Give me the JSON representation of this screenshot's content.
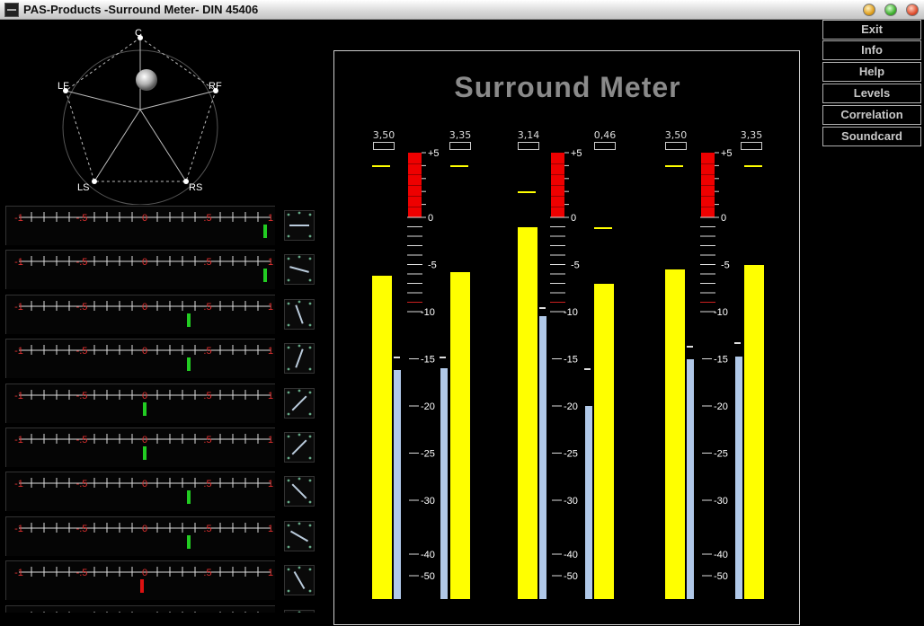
{
  "window": {
    "title": "PAS-Products -Surround Meter- DIN 45406"
  },
  "colors": {
    "meter": "#ffff00",
    "meter_secondary": "#b0c8e8",
    "over": "#ee0000",
    "corr_ok": "#22cc22",
    "corr_bad": "#dd1111",
    "background": "#000000"
  },
  "pentagon": {
    "labels": {
      "c": "C",
      "lf": "LF",
      "rf": "RF",
      "ls": "LS",
      "rs": "RS"
    }
  },
  "correlation": {
    "scale_labels": [
      "-1",
      "-.5",
      "0",
      ".5",
      "1"
    ],
    "rows": [
      {
        "value": 0.96,
        "color": "#22cc22"
      },
      {
        "value": 0.96,
        "color": "#22cc22"
      },
      {
        "value": 0.35,
        "color": "#22cc22"
      },
      {
        "value": 0.35,
        "color": "#22cc22"
      },
      {
        "value": 0.0,
        "color": "#22cc22"
      },
      {
        "value": 0.0,
        "color": "#22cc22"
      },
      {
        "value": 0.35,
        "color": "#22cc22"
      },
      {
        "value": 0.35,
        "color": "#22cc22"
      },
      {
        "value": -0.02,
        "color": "#dd1111"
      },
      {
        "value": 0.0,
        "color": "#22cc22"
      }
    ]
  },
  "meter": {
    "title": "Surround Meter",
    "scale_labels": [
      "+5",
      "0",
      "-5",
      "-10",
      "-15",
      "-20",
      "-25",
      "-30",
      "-40",
      "-50"
    ],
    "scale_values": [
      5,
      0,
      -5,
      -10,
      -15,
      -20,
      -25,
      -30,
      -40,
      -50
    ],
    "groups": [
      {
        "left_peak": "3,50",
        "right_peak": "3,35",
        "left_level": -6.2,
        "left_hold": 4.0,
        "left_rms": -16.2,
        "right_level": -5.8,
        "right_hold": 4.0,
        "right_rms": -16.0,
        "left_mark": -14.8,
        "right_mark": -14.8
      },
      {
        "left_peak": "3,14",
        "right_peak": "0,46",
        "left_level": -1.0,
        "left_hold": 2.0,
        "left_rms": -10.5,
        "right_level": -7.0,
        "right_hold": -1.0,
        "right_rms": -20.0,
        "left_mark": -9.5,
        "right_mark": -16.0
      },
      {
        "left_peak": "3,50",
        "right_peak": "3,35",
        "left_level": -5.5,
        "left_hold": 4.0,
        "left_rms": -15.0,
        "right_level": -5.0,
        "right_hold": 4.0,
        "right_rms": -14.8,
        "left_mark": -13.6,
        "right_mark": -13.2
      }
    ]
  },
  "menu": {
    "exit": "Exit",
    "info": "Info",
    "help": "Help",
    "levels": "Levels",
    "correlation": "Correlation",
    "soundcard": "Soundcard"
  }
}
